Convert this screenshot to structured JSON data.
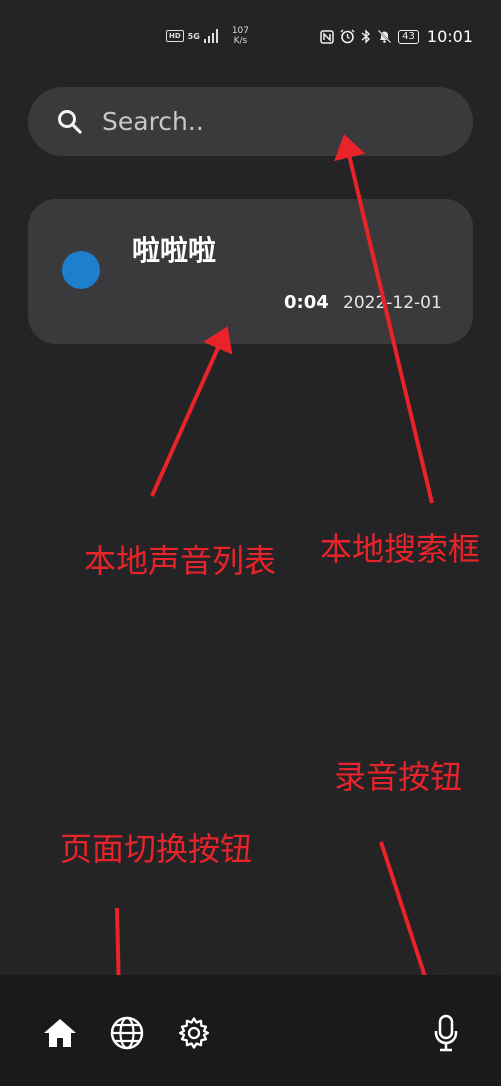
{
  "status_bar": {
    "hd": "HD",
    "net_type": "5G",
    "net_speed_value": "107",
    "net_speed_unit": "K/s",
    "battery": "43",
    "time": "10:01"
  },
  "search": {
    "placeholder": "Search.."
  },
  "records": [
    {
      "title": "啦啦啦",
      "duration": "0:04",
      "date": "2022-12-01"
    }
  ],
  "annotations": {
    "search_box": "本地搜索框",
    "sound_list": "本地声音列表",
    "record_button": "录音按钮",
    "page_switch": "页面切换按钮"
  },
  "nav": {
    "items": [
      "home-icon",
      "globe-icon",
      "gear-icon"
    ],
    "record_icon": "microphone-icon"
  },
  "colors": {
    "background": "#242426",
    "card": "#3a3a3c",
    "accent_dot": "#1f7fcf",
    "annotation": "#e8232a",
    "bottom_bar": "#1a1a1b"
  }
}
